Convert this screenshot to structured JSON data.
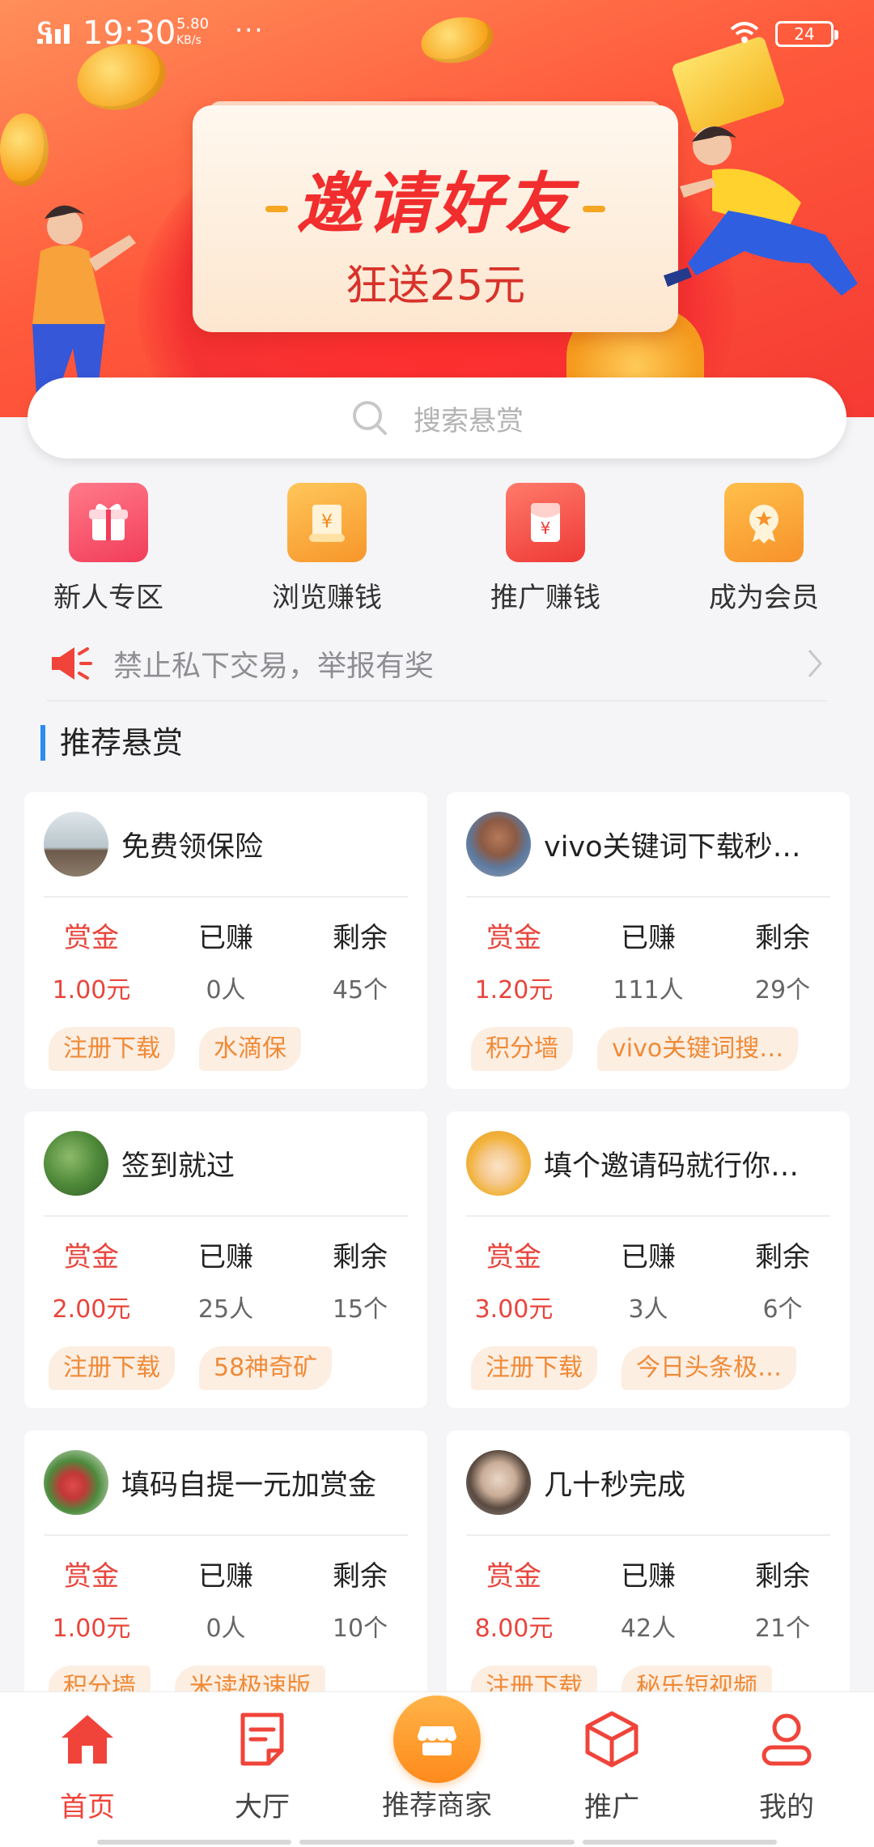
{
  "status_bar": {
    "network": "G",
    "time": "19:30",
    "speed_value": "5.80",
    "speed_unit": "KB/s",
    "more": "···",
    "battery": "24"
  },
  "banner": {
    "title": "邀请好友",
    "subtitle": "狂送25元"
  },
  "search": {
    "placeholder": "搜索悬赏"
  },
  "quick_entries": [
    {
      "label": "新人专区",
      "icon": "gift-icon",
      "color": "#f5475c"
    },
    {
      "label": "浏览赚钱",
      "icon": "scroll-yen-icon",
      "color": "#f7a12a"
    },
    {
      "label": "推广赚钱",
      "icon": "red-envelope-yen-icon",
      "color": "#f24a3d"
    },
    {
      "label": "成为会员",
      "icon": "badge-star-icon",
      "color": "#f79a25"
    }
  ],
  "notice": {
    "text": "禁止私下交易，举报有奖"
  },
  "section": {
    "title": "推荐悬赏"
  },
  "tasks": [
    {
      "title": "免费领保险",
      "reward_label": "赏金",
      "reward": "1.00元",
      "earned_label": "已赚",
      "earned": "0人",
      "remain_label": "剩余",
      "remain": "45个",
      "tags": [
        "注册下载",
        "水滴保"
      ]
    },
    {
      "title": "vivo关键词下载秒…",
      "reward_label": "赏金",
      "reward": "1.20元",
      "earned_label": "已赚",
      "earned": "111人",
      "remain_label": "剩余",
      "remain": "29个",
      "tags": [
        "积分墙",
        "vivo关键词搜…"
      ]
    },
    {
      "title": "签到就过",
      "reward_label": "赏金",
      "reward": "2.00元",
      "earned_label": "已赚",
      "earned": "25人",
      "remain_label": "剩余",
      "remain": "15个",
      "tags": [
        "注册下载",
        "58神奇矿"
      ]
    },
    {
      "title": "填个邀请码就行你…",
      "reward_label": "赏金",
      "reward": "3.00元",
      "earned_label": "已赚",
      "earned": "3人",
      "remain_label": "剩余",
      "remain": "6个",
      "tags": [
        "注册下载",
        "今日头条极…"
      ]
    },
    {
      "title": "填码自提一元加赏金",
      "reward_label": "赏金",
      "reward": "1.00元",
      "earned_label": "已赚",
      "earned": "0人",
      "remain_label": "剩余",
      "remain": "10个",
      "tags": [
        "积分墙",
        "米读极速版"
      ]
    },
    {
      "title": "几十秒完成",
      "reward_label": "赏金",
      "reward": "8.00元",
      "earned_label": "已赚",
      "earned": "42人",
      "remain_label": "剩余",
      "remain": "21个",
      "tags": [
        "注册下载",
        "秘乐短视频"
      ]
    }
  ],
  "bottom_nav": [
    {
      "label": "首页",
      "icon": "home-icon",
      "active": true
    },
    {
      "label": "大厅",
      "icon": "document-icon",
      "active": false
    },
    {
      "label": "推荐商家",
      "icon": "store-icon",
      "active": false
    },
    {
      "label": "推广",
      "icon": "cube-icon",
      "active": false
    },
    {
      "label": "我的",
      "icon": "user-icon",
      "active": false
    }
  ],
  "colors": {
    "accent_red": "#e8453c",
    "tag_orange": "#f08a36",
    "section_bar": "#2d8cf0"
  }
}
